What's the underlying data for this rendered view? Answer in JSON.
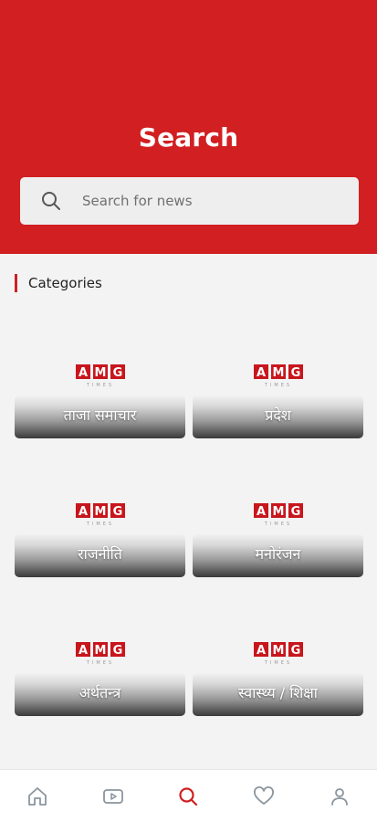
{
  "header": {
    "title": "Search"
  },
  "search": {
    "placeholder": "Search for news"
  },
  "categories": {
    "heading": "Categories",
    "logo_text": "AMG",
    "logo_subtext": "TIMES",
    "items": [
      {
        "label": "ताजा समाचार"
      },
      {
        "label": "प्रदेश"
      },
      {
        "label": "राजनीति"
      },
      {
        "label": "मनोरंजन"
      },
      {
        "label": "अर्थतन्त्र"
      },
      {
        "label": "स्वास्थ्य / शिक्षा"
      }
    ]
  },
  "tabbar": {
    "items": [
      {
        "icon": "home-icon"
      },
      {
        "icon": "video-icon"
      },
      {
        "icon": "search-icon",
        "active": true
      },
      {
        "icon": "heart-icon"
      },
      {
        "icon": "user-icon"
      }
    ]
  },
  "colors": {
    "accent": "#d11f22",
    "inactive_icon": "#8a959e"
  }
}
